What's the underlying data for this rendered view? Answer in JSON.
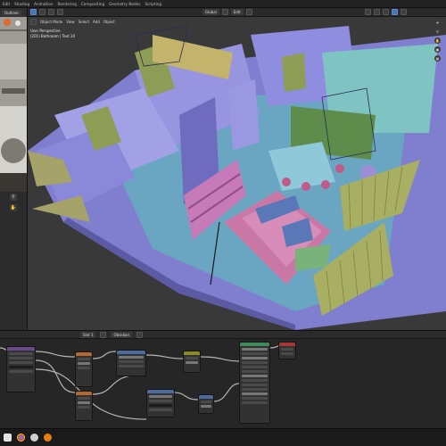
{
  "topbar": {
    "workspaces": [
      "Edit",
      "Shading",
      "Animation",
      "Rendering",
      "Compositing",
      "Geometry Nodes",
      "Scripting"
    ]
  },
  "toolbar": {
    "view_mode": "Global",
    "snap_mode": "Edit"
  },
  "left_panel": {
    "editor_label": "Outliner"
  },
  "viewport": {
    "mode": "Object Mode",
    "menus": [
      "View",
      "Select",
      "Add",
      "Object"
    ],
    "info_line1": "User Perspective",
    "info_line2": "(201) Bathroom | Text.10"
  },
  "node_editor": {
    "slot_label": "Slot 1",
    "material_label": "Obsidian"
  },
  "colors": {
    "room_fill": "#8a88d8",
    "wall_dark": "#5a5aa0",
    "floor_teal": "#67a3c0",
    "rug_pink": "#c77aa3",
    "curtain_olive": "#a8ae62",
    "accent_blue": "#4772b3"
  }
}
